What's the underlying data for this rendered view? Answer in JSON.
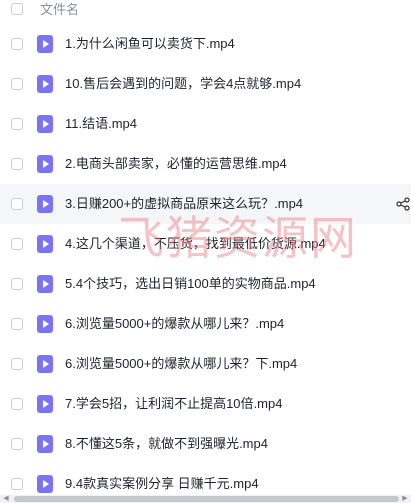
{
  "header": {
    "column_label": "文件名"
  },
  "files": [
    {
      "name": "1.为什么闲鱼可以卖货下.mp4"
    },
    {
      "name": "10.售后会遇到的问题，学会4点就够.mp4"
    },
    {
      "name": "11.结语.mp4"
    },
    {
      "name": "2.电商头部卖家，必懂的运营思维.mp4"
    },
    {
      "name": "3.日赚200+的虚拟商品原来这么玩？.mp4"
    },
    {
      "name": "4.这几个渠道，不压货，找到最低价货源.mp4"
    },
    {
      "name": "5.4个技巧，选出日销100单的实物商品.mp4"
    },
    {
      "name": "6.浏览量5000+的爆款从哪儿来？.mp4"
    },
    {
      "name": "6.浏览量5000+的爆款从哪儿来？下.mp4"
    },
    {
      "name": "7.学会5招，让利润不止提高10倍.mp4"
    },
    {
      "name": "8.不懂这5条，就做不到强曝光.mp4"
    },
    {
      "name": "9.4款真实案例分享 日赚千元.mp4"
    }
  ],
  "highlighted_row_index": 4,
  "watermark": "飞猪资源网",
  "colors": {
    "file_icon": "#7b74f0",
    "row_highlight": "#f5f6f8",
    "watermark": "#e87884"
  },
  "icons": {
    "file": "video-file-icon",
    "share": "share-icon"
  }
}
